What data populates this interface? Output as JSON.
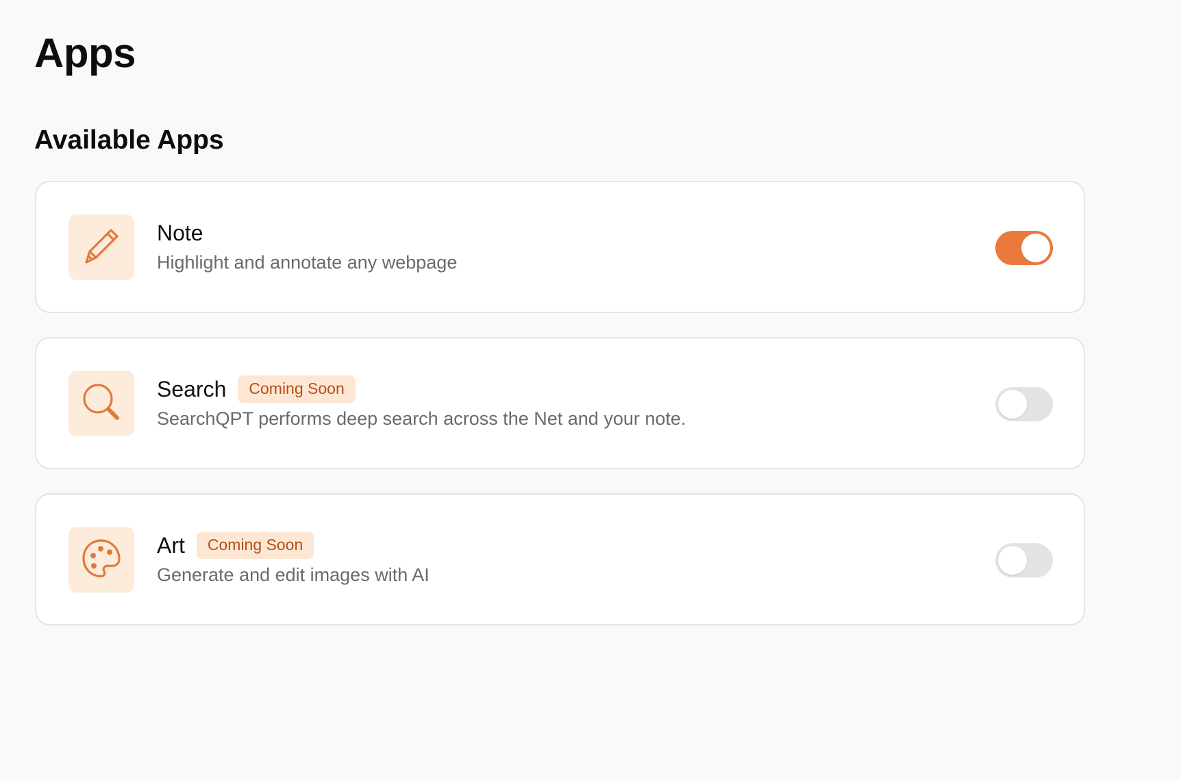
{
  "page": {
    "title": "Apps"
  },
  "section": {
    "title": "Available Apps"
  },
  "accent_color": "#ea7a3b",
  "apps": [
    {
      "name": "Note",
      "description": "Highlight and annotate any webpage",
      "icon": "pencil-icon",
      "badge": "",
      "enabled": true
    },
    {
      "name": "Search",
      "description": "SearchQPT performs deep search across the Net and your note.",
      "icon": "search-icon",
      "badge": "Coming Soon",
      "enabled": false
    },
    {
      "name": "Art",
      "description": "Generate and edit images with AI",
      "icon": "palette-icon",
      "badge": "Coming Soon",
      "enabled": false
    }
  ]
}
